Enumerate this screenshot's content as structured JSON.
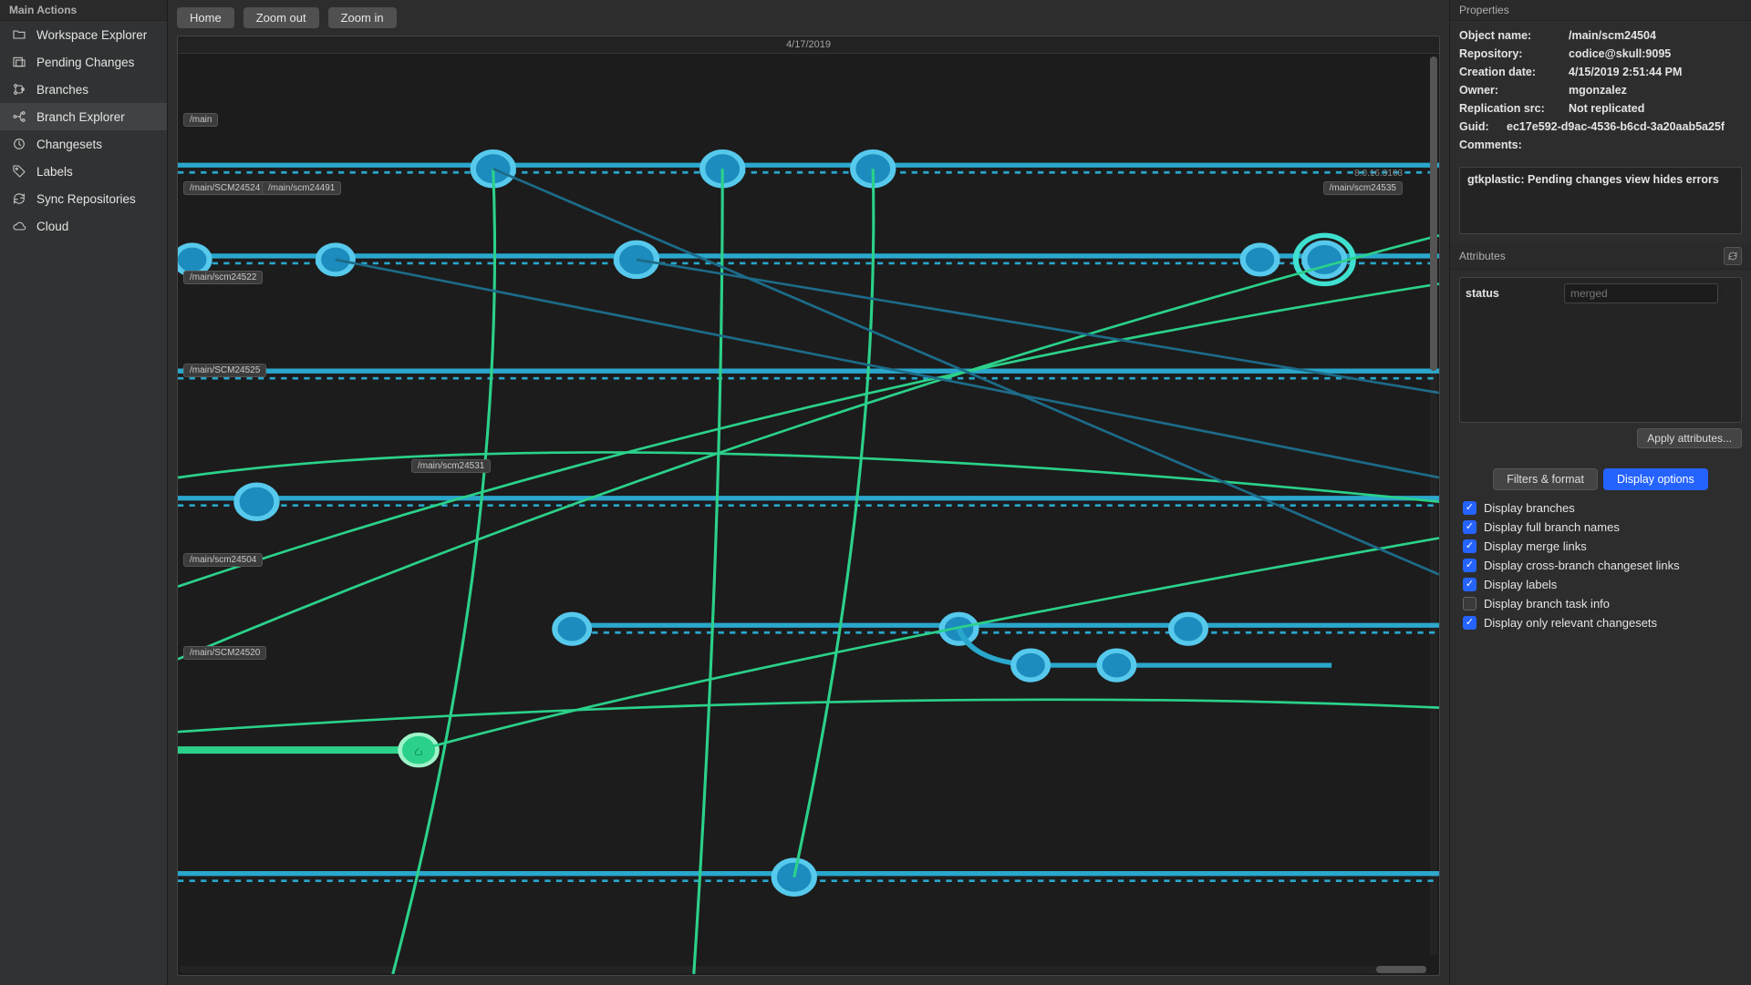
{
  "sidebar": {
    "header": "Main Actions",
    "items": [
      {
        "label": "Workspace Explorer",
        "icon": "folder",
        "active": false
      },
      {
        "label": "Pending Changes",
        "icon": "pending",
        "active": false
      },
      {
        "label": "Branches",
        "icon": "branches",
        "active": false
      },
      {
        "label": "Branch Explorer",
        "icon": "branch-explorer",
        "active": true
      },
      {
        "label": "Changesets",
        "icon": "changesets",
        "active": false
      },
      {
        "label": "Labels",
        "icon": "labels",
        "active": false
      },
      {
        "label": "Sync Repositories",
        "icon": "sync",
        "active": false
      },
      {
        "label": "Cloud",
        "icon": "cloud",
        "active": false
      }
    ]
  },
  "toolbar": {
    "home": "Home",
    "zoom_out": "Zoom out",
    "zoom_in": "Zoom in"
  },
  "graph": {
    "date_header": "4/17/2019",
    "version_label": "8.0.16.3163",
    "branches": {
      "main": "/main",
      "scm24524": "/main/SCM24524",
      "scm24491": "/main/scm24491",
      "scm24535": "/main/scm24535",
      "scm24522": "/main/scm24522",
      "scm24525": "/main/SCM24525",
      "scm24531": "/main/scm24531",
      "scm24504": "/main/scm24504",
      "scm24520": "/main/SCM24520"
    }
  },
  "properties": {
    "header": "Properties",
    "rows": {
      "object_name": {
        "k": "Object name:",
        "v": "/main/scm24504"
      },
      "repository": {
        "k": "Repository:",
        "v": "codice@skull:9095"
      },
      "creation_date": {
        "k": "Creation date:",
        "v": "4/15/2019 2:51:44 PM"
      },
      "owner": {
        "k": "Owner:",
        "v": "mgonzalez"
      },
      "replication_src": {
        "k": "Replication src:",
        "v": "Not replicated"
      },
      "guid": {
        "k": "Guid:",
        "v": "ec17e592-d9ac-4536-b6cd-3a20aab5a25f"
      },
      "comments_label": {
        "k": "Comments:"
      }
    },
    "comments_value": "gtkplastic: Pending changes view hides errors"
  },
  "attributes": {
    "header": "Attributes",
    "rows": [
      {
        "name": "status",
        "placeholder": "merged"
      }
    ],
    "apply_label": "Apply attributes..."
  },
  "display_panel": {
    "tabs": {
      "filters": "Filters & format",
      "display_options": "Display options"
    },
    "options": [
      {
        "label": "Display branches",
        "checked": true
      },
      {
        "label": "Display full branch names",
        "checked": true
      },
      {
        "label": "Display merge links",
        "checked": true
      },
      {
        "label": "Display cross-branch changeset links",
        "checked": true
      },
      {
        "label": "Display labels",
        "checked": true
      },
      {
        "label": "Display branch task info",
        "checked": false
      },
      {
        "label": "Display only relevant changesets",
        "checked": true
      }
    ]
  }
}
